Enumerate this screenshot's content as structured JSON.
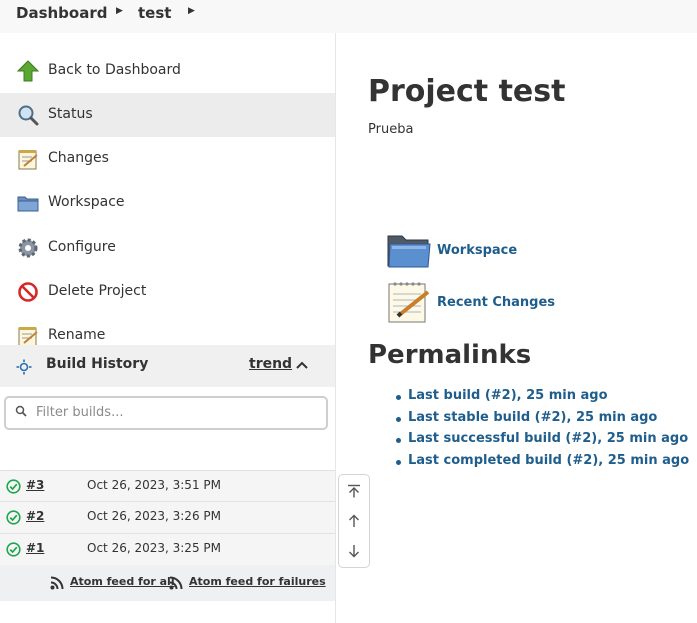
{
  "breadcrumb": {
    "items": [
      {
        "label": "Dashboard"
      },
      {
        "label": "test"
      }
    ]
  },
  "sidebar": {
    "tasks": [
      {
        "label": "Back to Dashboard",
        "icon": "up-arrow-icon"
      },
      {
        "label": "Status",
        "icon": "magnifier-icon",
        "active": true
      },
      {
        "label": "Changes",
        "icon": "notepad-icon"
      },
      {
        "label": "Workspace",
        "icon": "folder-icon"
      },
      {
        "label": "Configure",
        "icon": "gear-icon"
      },
      {
        "label": "Delete Project",
        "icon": "no-entry-icon"
      },
      {
        "label": "Rename",
        "icon": "notepad-icon"
      }
    ]
  },
  "build_history": {
    "title": "Build History",
    "trend_label": "trend",
    "filter": {
      "placeholder": "Filter builds..."
    },
    "builds": [
      {
        "number": "#3",
        "time": "Oct 26, 2023, 3:51 PM",
        "status": "success"
      },
      {
        "number": "#2",
        "time": "Oct 26, 2023, 3:26 PM",
        "status": "success"
      },
      {
        "number": "#1",
        "time": "Oct 26, 2023, 3:25 PM",
        "status": "success"
      }
    ],
    "feeds": {
      "all": "Atom feed for all",
      "failures": "Atom feed for failures"
    }
  },
  "main": {
    "title": "Project test",
    "description": "Prueba",
    "links": [
      {
        "label": "Workspace",
        "icon": "folder-icon"
      },
      {
        "label": "Recent Changes",
        "icon": "notepad-icon"
      }
    ],
    "permalinks_title": "Permalinks",
    "permalinks": [
      "Last build (#2), 25 min ago",
      "Last stable build (#2), 25 min ago",
      "Last successful build (#2), 25 min ago",
      "Last completed build (#2), 25 min ago"
    ]
  },
  "colors": {
    "link": "#1f5e8c",
    "success": "#1ea64b",
    "active_row": "#ececec"
  }
}
